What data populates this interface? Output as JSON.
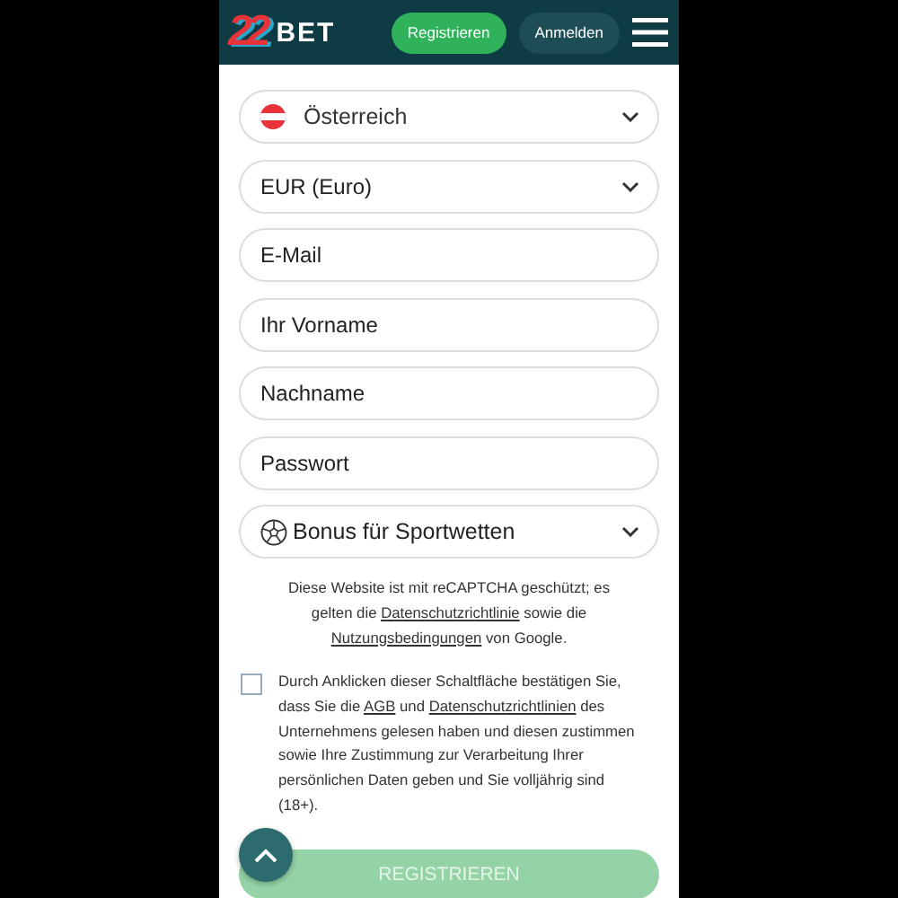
{
  "header": {
    "logo_number": "22",
    "logo_text": "BET",
    "buttons": [
      {
        "label": "Registrieren",
        "kind": "primary"
      },
      {
        "label": "Anmelden",
        "kind": "secondary"
      }
    ]
  },
  "fields": [
    {
      "kind": "country-select",
      "value": "Österreich"
    },
    {
      "kind": "select",
      "value": "EUR (Euro)"
    },
    {
      "kind": "input",
      "placeholder": "E-Mail"
    },
    {
      "kind": "input",
      "placeholder": "Ihr Vorname"
    },
    {
      "kind": "input",
      "placeholder": "Nachname"
    },
    {
      "kind": "input",
      "placeholder": "Passwort"
    },
    {
      "kind": "bonus-select",
      "value": "Bonus für Sportwetten"
    }
  ],
  "recaptcha_note": [
    {
      "kind": "text",
      "text": "Diese Website ist mit reCAPTCHA geschützt; es gelten die "
    },
    {
      "kind": "link",
      "text": "Datenschutzrichtlinie"
    },
    {
      "kind": "text",
      "text": " sowie die "
    },
    {
      "kind": "link",
      "text": "Nutzungsbedingungen"
    },
    {
      "kind": "text",
      "text": " von Google."
    }
  ],
  "consent": {
    "checked": false,
    "segments": [
      {
        "kind": "text",
        "text": "Durch Anklicken dieser Schaltfläche bestätigen Sie, dass Sie die "
      },
      {
        "kind": "link",
        "text": "AGB"
      },
      {
        "kind": "text",
        "text": " und "
      },
      {
        "kind": "link",
        "text": "Datenschutzrichtlinien"
      },
      {
        "kind": "text",
        "text": " des Unternehmens gelesen haben und diesen zustimmen sowie Ihre Zustimmung zur Verarbeitung Ihrer persönlichen Daten geben und Sie volljährig sind (18+)."
      }
    ]
  },
  "submit_button": {
    "label": "REGISTRIEREN",
    "disabled": true
  }
}
